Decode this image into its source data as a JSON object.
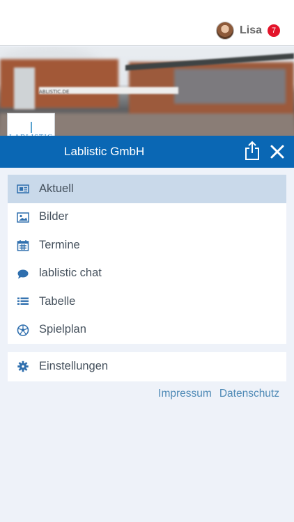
{
  "header": {
    "user_name": "Lisa",
    "notification_count": "7"
  },
  "hero": {
    "sign_text": "ABLISTIC.DE"
  },
  "logo": {
    "text": "LABLISTIC"
  },
  "bluebar": {
    "company_name": "Lablistic GmbH"
  },
  "menu": {
    "items": [
      {
        "label": "Aktuell",
        "icon": "newspaper-icon",
        "active": true
      },
      {
        "label": "Bilder",
        "icon": "image-icon",
        "active": false
      },
      {
        "label": "Termine",
        "icon": "calendar-icon",
        "active": false
      },
      {
        "label": "lablistic chat",
        "icon": "chat-bubble-icon",
        "active": false
      },
      {
        "label": "Tabelle",
        "icon": "list-icon",
        "active": false
      },
      {
        "label": "Spielplan",
        "icon": "soccer-ball-icon",
        "active": false
      }
    ]
  },
  "settings": {
    "label": "Einstellungen",
    "icon": "gear-icon"
  },
  "footer": {
    "impressum": "Impressum",
    "datenschutz": "Datenschutz"
  },
  "colors": {
    "brand_blue": "#0a67b4",
    "active_item": "#c9d9ea",
    "background": "#eef2f9",
    "badge_red": "#e3142a",
    "link": "#4f8ab6"
  }
}
